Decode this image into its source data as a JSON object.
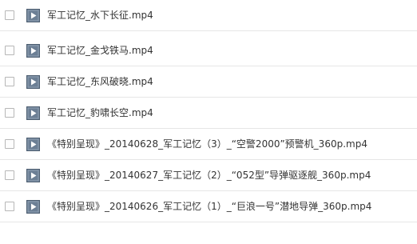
{
  "files": [
    {
      "name": "军工记忆_水下长征.mp4"
    },
    {
      "name": "军工记忆_金戈铁马.mp4"
    },
    {
      "name": "军工记忆_东风破晓.mp4"
    },
    {
      "name": "军工记忆_豹啸长空.mp4"
    },
    {
      "name": "《特别呈现》_20140628_军工记忆（3）_“空警2000”预警机_360p.mp4"
    },
    {
      "name": "《特别呈现》_20140627_军工记忆（2）_“052型”导弹驱逐舰_360p.mp4"
    },
    {
      "name": "《特别呈现》_20140626_军工记忆（1）_“巨浪一号”潜地导弹_360p.mp4"
    }
  ],
  "icon": "video-file-icon",
  "colors": {
    "icon_bg": "#6c7f95",
    "icon_border": "#4c5d70",
    "icon_play": "#ffffff",
    "divider": "#e6e6e6",
    "text": "#333333"
  }
}
